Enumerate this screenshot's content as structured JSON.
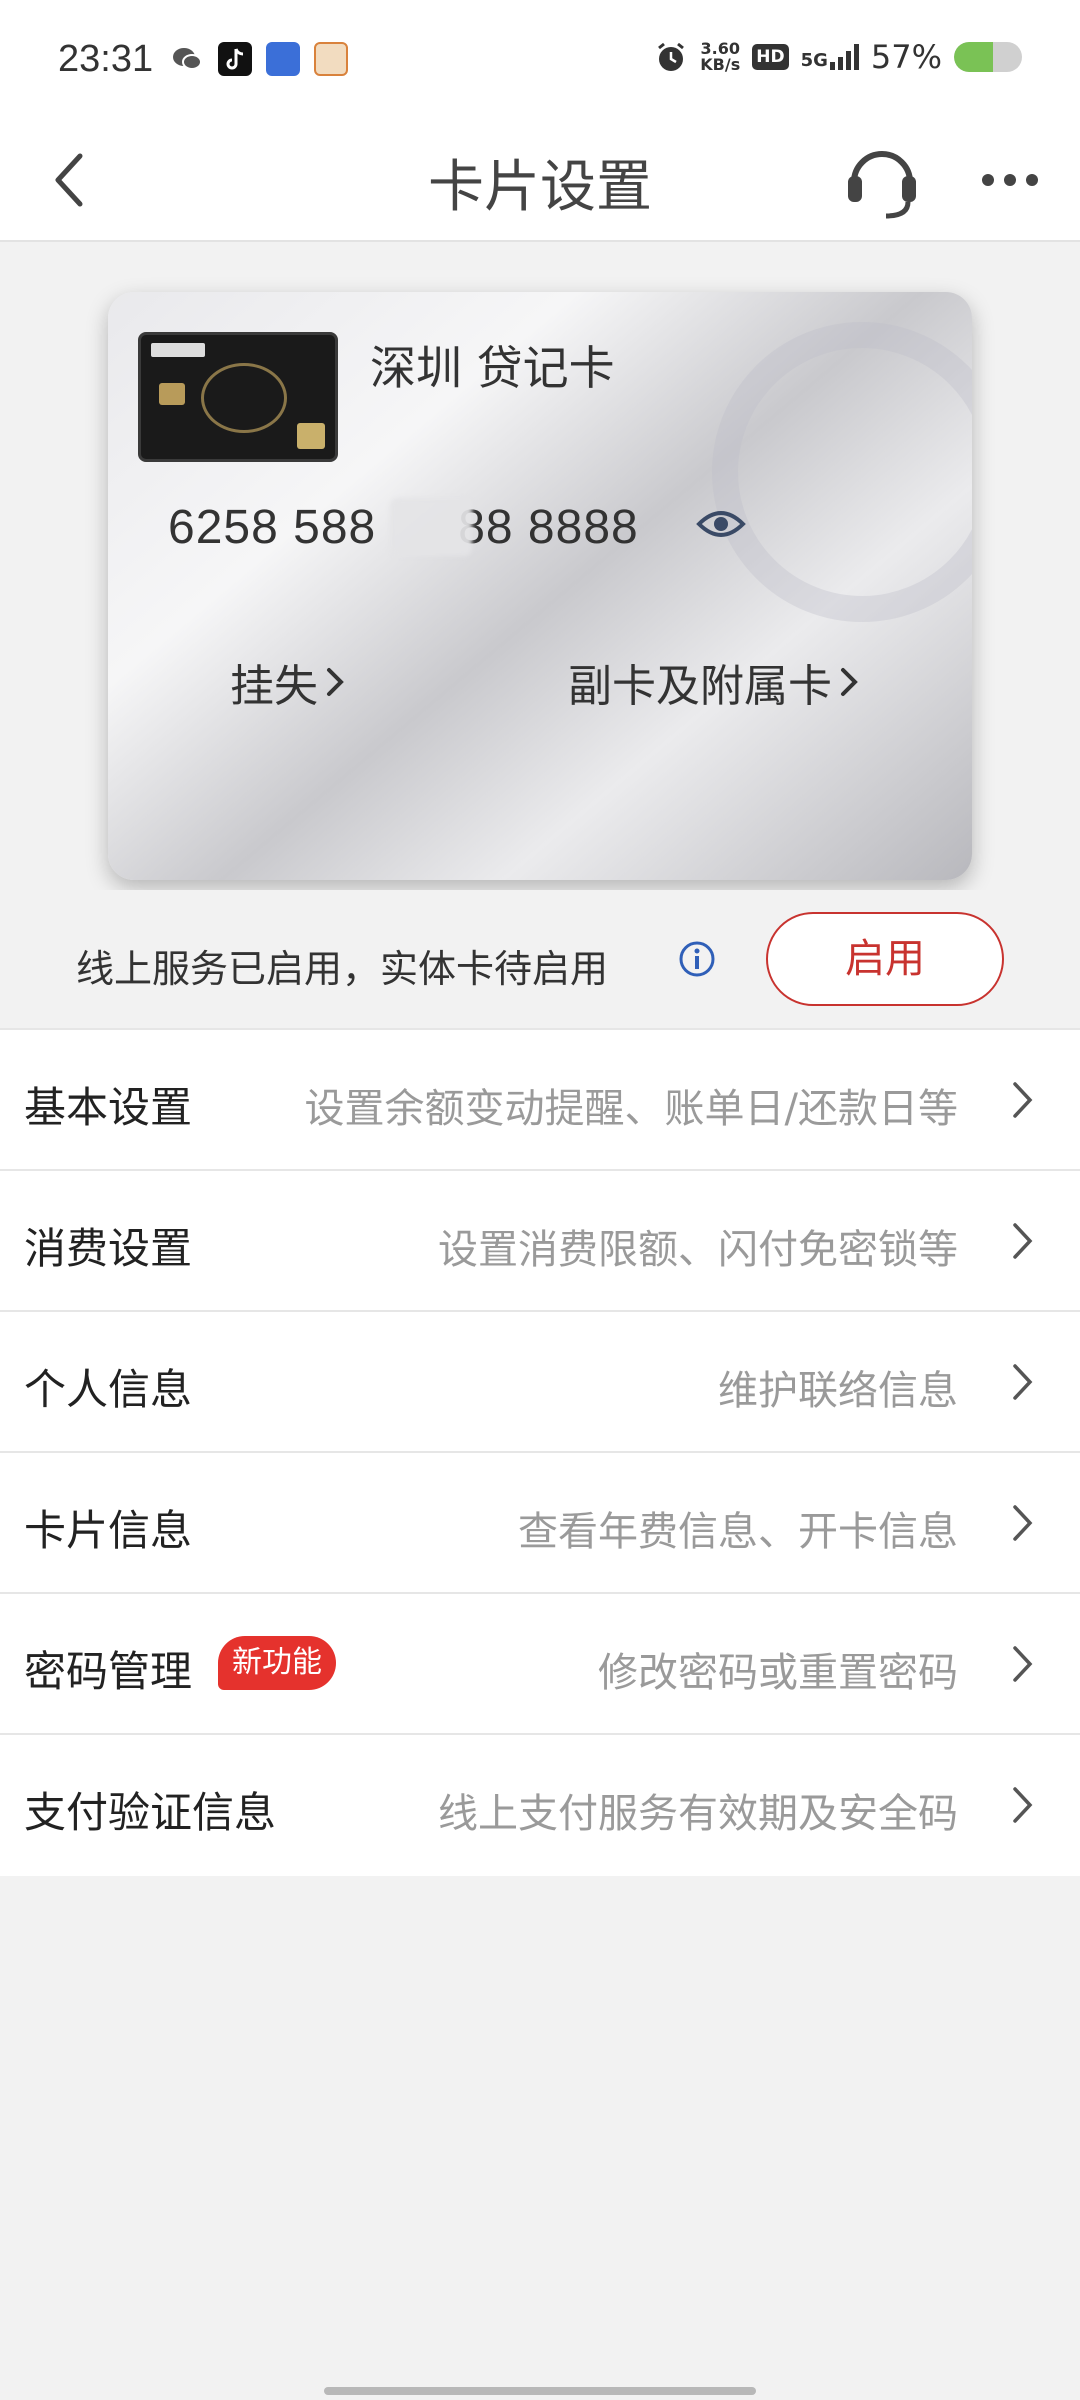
{
  "status_bar": {
    "time": "23:31",
    "notification_icons": [
      "wechat-icon",
      "tiktok-icon",
      "app-icon-blue",
      "app-icon-orange"
    ],
    "network_speed_value": "3.60",
    "network_speed_unit": "KB/s",
    "hd_label": "HD",
    "network_type": "5G",
    "battery_text": "57%",
    "battery_level": 0.57,
    "colors": {
      "battery_fill": "#7ac255"
    }
  },
  "nav": {
    "title": "卡片设置",
    "back_icon": "chevron-left-icon",
    "service_icon": "headset-icon",
    "more_icon": "more-dots-icon"
  },
  "card": {
    "name": "深圳 贷记卡",
    "number_prefix": "6258 588",
    "number_suffix": "88 8888",
    "eye_icon": "eye-icon",
    "report_loss_label": "挂失",
    "supplementary_label": "副卡及附属卡"
  },
  "activation": {
    "status_text": "线上服务已启用，实体卡待启用",
    "info_icon": "info-icon",
    "button_label": "启用",
    "colors": {
      "accent": "#c8332f"
    }
  },
  "menu": {
    "items": [
      {
        "label": "基本设置",
        "desc": "设置余额变动提醒、账单日/还款日等"
      },
      {
        "label": "消费设置",
        "desc": "设置消费限额、闪付免密锁等"
      },
      {
        "label": "个人信息",
        "desc": "维护联络信息"
      },
      {
        "label": "卡片信息",
        "desc": "查看年费信息、开卡信息"
      },
      {
        "label": "密码管理",
        "badge": "新功能",
        "desc": "修改密码或重置密码"
      },
      {
        "label": "支付验证信息",
        "desc": "线上支付服务有效期及安全码"
      }
    ],
    "colors": {
      "badge": "#e5322d",
      "desc": "#9a9a9a"
    }
  }
}
